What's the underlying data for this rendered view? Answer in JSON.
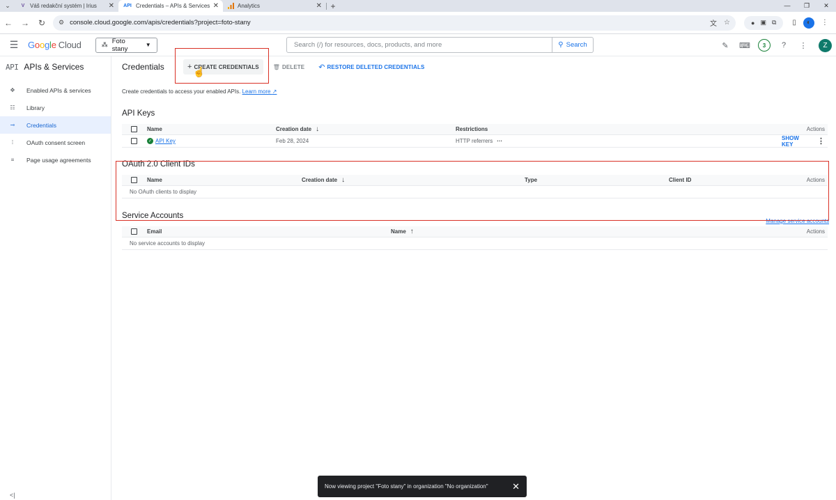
{
  "browser": {
    "tabs": [
      {
        "title": "Váš redakční systém | Irius",
        "favicon": "V"
      },
      {
        "title": "Credentials – APIs & Services –",
        "favicon": "API",
        "active": true
      },
      {
        "title": "Analytics",
        "favicon": "analytics-bars"
      }
    ],
    "url": "console.cloud.google.com/apis/credentials?project=foto-stany"
  },
  "header": {
    "logo": {
      "google": "Google",
      "cloud": "Cloud"
    },
    "project": "Foto stany",
    "search_placeholder": "Search (/) for resources, docs, products, and more",
    "search_button": "Search",
    "notifications": "3",
    "avatar": "Z"
  },
  "sidebar": {
    "logo": "API",
    "title": "APIs & Services",
    "items": [
      {
        "label": "Enabled APIs & services",
        "icon": "hub-icon"
      },
      {
        "label": "Library",
        "icon": "grid-icon"
      },
      {
        "label": "Credentials",
        "icon": "key-icon",
        "active": true
      },
      {
        "label": "OAuth consent screen",
        "icon": "consent-icon"
      },
      {
        "label": "Page usage agreements",
        "icon": "list-settings-icon"
      }
    ],
    "collapse": "<|"
  },
  "main": {
    "title": "Credentials",
    "toolbar": {
      "create": "CREATE CREDENTIALS",
      "delete": "DELETE",
      "restore": "RESTORE DELETED CREDENTIALS"
    },
    "intro_text": "Create credentials to access your enabled APIs.",
    "learn_more": "Learn more",
    "api_keys": {
      "title": "API Keys",
      "columns": {
        "name": "Name",
        "date": "Creation date",
        "restrictions": "Restrictions",
        "actions": "Actions"
      },
      "rows": [
        {
          "name": "API Key",
          "date": "Feb 28, 2024",
          "restrictions": "HTTP referrers",
          "action": "SHOW KEY"
        }
      ]
    },
    "oauth": {
      "title": "OAuth 2.0 Client IDs",
      "columns": {
        "name": "Name",
        "date": "Creation date",
        "type": "Type",
        "client_id": "Client ID",
        "actions": "Actions"
      },
      "empty": "No OAuth clients to display"
    },
    "service_accounts": {
      "title": "Service Accounts",
      "manage": "Manage service accounts",
      "columns": {
        "email": "Email",
        "name": "Name",
        "actions": "Actions"
      },
      "empty": "No service accounts to display"
    }
  },
  "snackbar": {
    "text": "Now viewing project \"Foto stany\" in organization \"No organization\""
  },
  "colors": {
    "accent": "#1a73e8",
    "highlight": "#d93025",
    "success": "#188038"
  }
}
